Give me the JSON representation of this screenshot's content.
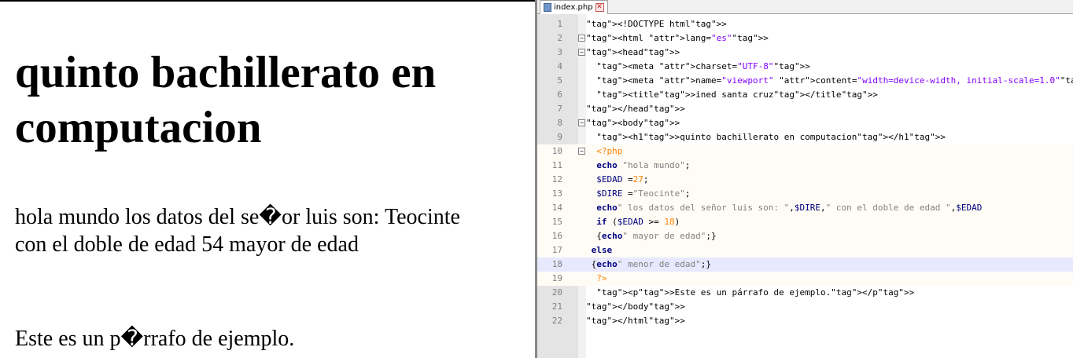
{
  "browser": {
    "heading": "quinto bachillerato en computacion",
    "paragraph1": "hola mundo los datos del se�or luis son: Teocinte con el doble de edad 54 mayor de edad",
    "paragraph2": "Este es un p�rrafo de ejemplo."
  },
  "editor": {
    "tab": {
      "filename": "index.php",
      "file_icon": "php-file-icon",
      "close_icon": "close-icon"
    },
    "lines": [
      {
        "n": "1",
        "code": "<!DOCTYPE html>"
      },
      {
        "n": "2",
        "code": "<html lang=\"es\">"
      },
      {
        "n": "3",
        "code": "<head>"
      },
      {
        "n": "4",
        "code": "  <meta charset=\"UTF-8\">"
      },
      {
        "n": "5",
        "code": "  <meta name=\"viewport\" content=\"width=device-width, initial-scale=1.0\">"
      },
      {
        "n": "6",
        "code": "  <title>ined santa cruz</title>"
      },
      {
        "n": "7",
        "code": "</head>"
      },
      {
        "n": "8",
        "code": "<body>"
      },
      {
        "n": "9",
        "code": "  <h1>quinto bachillerato en computacion</h1>"
      },
      {
        "n": "10",
        "code": "  <?php"
      },
      {
        "n": "11",
        "code": "  echo \"hola mundo\";"
      },
      {
        "n": "12",
        "code": "  $EDAD =27;"
      },
      {
        "n": "13",
        "code": "  $DIRE =\"Teocinte\";"
      },
      {
        "n": "14",
        "code": "  echo\" los datos del señor luis son: \",$DIRE,\" con el doble de edad \",$EDAD"
      },
      {
        "n": "15",
        "code": "  if ($EDAD >= 18)"
      },
      {
        "n": "16",
        "code": "  {echo\" mayor de edad\";}"
      },
      {
        "n": "17",
        "code": " else"
      },
      {
        "n": "18",
        "code": " {echo\" menor de edad\";}"
      },
      {
        "n": "19",
        "code": "  ?>"
      },
      {
        "n": "20",
        "code": "  <p>Este es un párrafo de ejemplo.</p>"
      },
      {
        "n": "21",
        "code": "</body>"
      },
      {
        "n": "22",
        "code": "</html>"
      }
    ]
  },
  "colors": {
    "tag": "#0000ff",
    "attribute": "#ff0000",
    "string": "#8000ff",
    "php_delimiter": "#ff8000",
    "keyword": "#000080",
    "php_string": "#808080",
    "current_line": "#e8e8ff"
  }
}
